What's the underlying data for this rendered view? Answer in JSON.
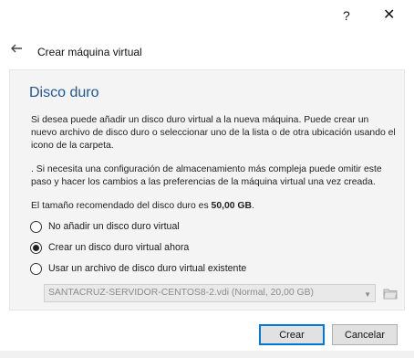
{
  "window": {
    "help_label": "?",
    "close_label": "✕"
  },
  "header": {
    "title": "Crear máquina virtual"
  },
  "page": {
    "title": "Disco duro",
    "paragraph1": "Si desea puede añadir un disco duro virtual a la nueva máquina. Puede crear un nuevo archivo de disco duro o seleccionar uno de la lista o de otra ubicación usando el icono de la carpeta.",
    "paragraph2": ". Si necesita una configuración de almacenamiento más compleja puede omitir este paso y hacer los cambios a las preferencias de la máquina virtual una vez creada.",
    "recommended_prefix": "El tamaño recomendado del disco duro es",
    "recommended_size": "50,00 GB",
    "recommended_suffix": "."
  },
  "options": [
    {
      "label": "No añadir un disco duro virtual",
      "selected": false
    },
    {
      "label": "Crear un disco duro virtual ahora",
      "selected": true
    },
    {
      "label": "Usar un archivo de disco duro virtual existente",
      "selected": false
    }
  ],
  "existing_disk": {
    "selected_value": "SANTACRUZ-SERVIDOR-CENTOS8-2.vdi (Normal, 20,00 GB)"
  },
  "footer": {
    "create_label": "Crear",
    "cancel_label": "Cancelar"
  },
  "colors": {
    "title_blue": "#1e5799",
    "focus_blue": "#0078d7"
  },
  "icons": {
    "back": "back-arrow-icon",
    "folder": "folder-icon",
    "dropdown": "chevron-down-icon"
  }
}
